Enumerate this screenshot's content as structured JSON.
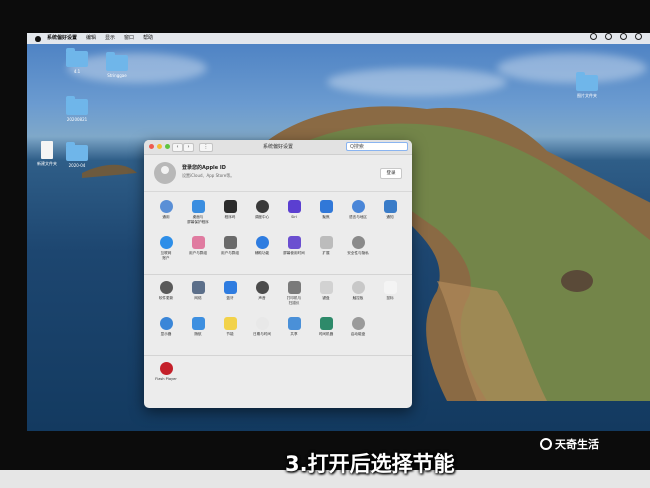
{
  "menubar": {
    "items": [
      "系统偏好设置",
      "编辑",
      "显示",
      "窗口",
      "帮助"
    ]
  },
  "desktop": {
    "icons": [
      {
        "label": "4.1"
      },
      {
        "label": "Stringgae"
      },
      {
        "label": "20200821"
      },
      {
        "label": "新建文件夹"
      },
      {
        "label": "2020-04"
      },
      {
        "label": "图片文件夹"
      }
    ]
  },
  "window": {
    "title": "系统偏好设置",
    "search_placeholder": "Q搜索",
    "account_title": "登录您的Apple ID",
    "account_subtitle": "设置iCloud、App Store等。",
    "login_button": "登录",
    "row1": [
      {
        "label": "通用",
        "icon": "general-icon",
        "color": "#5a8fd6"
      },
      {
        "label": "桌面与\n屏幕保护程序",
        "icon": "desktop-icon",
        "color": "#3b8ee0"
      },
      {
        "label": "程序坞",
        "icon": "dock-icon",
        "color": "#2c2c2c"
      },
      {
        "label": "调度中心",
        "icon": "mission-control-icon",
        "color": "#3a3a3a"
      },
      {
        "label": "Siri",
        "icon": "siri-icon",
        "color": "#5b3fd1"
      },
      {
        "label": "聚焦",
        "icon": "spotlight-icon",
        "color": "#3178d8"
      },
      {
        "label": "语言与地区",
        "icon": "language-icon",
        "color": "#4a86d8"
      },
      {
        "label": "通知",
        "icon": "notifications-icon",
        "color": "#3a7cc8"
      }
    ],
    "row2": [
      {
        "label": "互联网\n账户",
        "icon": "internet-accounts-icon",
        "color": "#2d8ee8"
      },
      {
        "label": "用户与群组",
        "icon": "users-icon",
        "color": "#e07ba0"
      },
      {
        "label": "用户与群组",
        "icon": "users-groups-icon",
        "color": "#6a6a6a"
      },
      {
        "label": "辅助功能",
        "icon": "accessibility-icon",
        "color": "#2e7ce0"
      },
      {
        "label": "屏幕使用时间",
        "icon": "screen-time-icon",
        "color": "#6b4fd0"
      },
      {
        "label": "扩展",
        "icon": "extensions-icon",
        "color": "#bcbcbc"
      },
      {
        "label": "安全性与隐私",
        "icon": "security-icon",
        "color": "#8a8a8a"
      },
      {
        "label": "",
        "icon": "blank-icon",
        "color": "#ececec"
      }
    ],
    "row3": [
      {
        "label": "软件更新",
        "icon": "software-update-icon",
        "color": "#5a5a5a"
      },
      {
        "label": "网络",
        "icon": "network-icon",
        "color": "#5c6f8a"
      },
      {
        "label": "蓝牙",
        "icon": "bluetooth-icon",
        "color": "#2e7ce0"
      },
      {
        "label": "声音",
        "icon": "sound-icon",
        "color": "#4b4b4b"
      },
      {
        "label": "打印机与\n扫描仪",
        "icon": "printer-icon",
        "color": "#7a7a7a"
      },
      {
        "label": "键盘",
        "icon": "keyboard-icon",
        "color": "#d2d2d2"
      },
      {
        "label": "触控板",
        "icon": "trackpad-icon",
        "color": "#c8c8c8"
      },
      {
        "label": "鼠标",
        "icon": "mouse-icon",
        "color": "#f4f4f4"
      }
    ],
    "row4": [
      {
        "label": "显示器",
        "icon": "display-icon",
        "color": "#3a86d8"
      },
      {
        "label": "随航",
        "icon": "sidecar-icon",
        "color": "#3d8fe0"
      },
      {
        "label": "节能",
        "icon": "energy-saver-icon",
        "color": "#f2d24a"
      },
      {
        "label": "日期与时间",
        "icon": "date-time-icon",
        "color": "#e8e8e8"
      },
      {
        "label": "共享",
        "icon": "sharing-icon",
        "color": "#4a90d8"
      },
      {
        "label": "时间机器",
        "icon": "time-machine-icon",
        "color": "#2e8a6a"
      },
      {
        "label": "启动磁盘",
        "icon": "startup-disk-icon",
        "color": "#9a9a9a"
      },
      {
        "label": "",
        "icon": "blank-icon",
        "color": "#ececec"
      }
    ],
    "other": [
      {
        "label": "Flash Player",
        "icon": "flash-player-icon",
        "color": "#c4202a"
      }
    ]
  },
  "caption": "3.打开后选择节能",
  "watermark": "天奇生活"
}
